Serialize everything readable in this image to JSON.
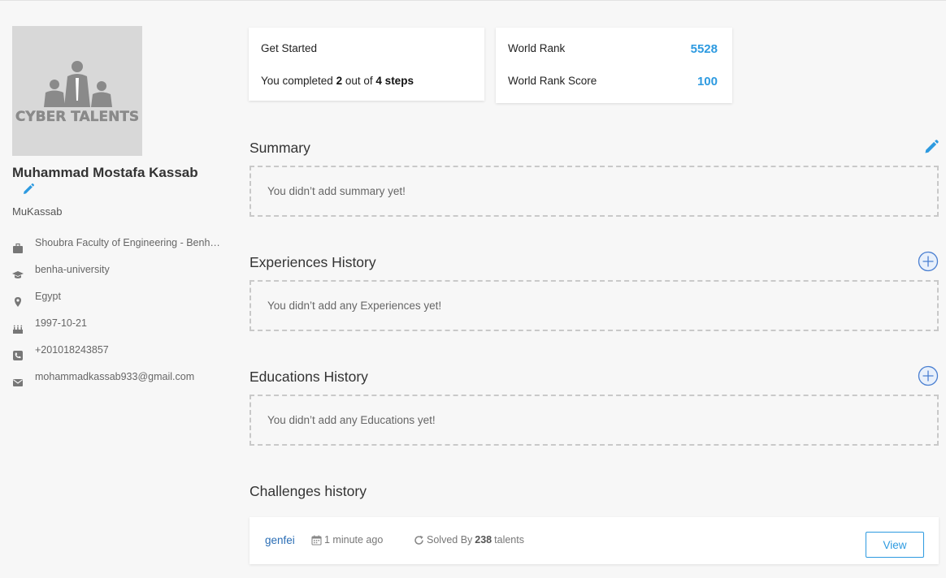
{
  "profile": {
    "logo_text": "CYBER TALENTS",
    "full_name": "Muhammad Mostafa Kassab",
    "username": "MuKassab",
    "info": [
      {
        "icon": "briefcase-icon",
        "text": "Shoubra Faculty of Engineering - Benha University"
      },
      {
        "icon": "graduation-cap-icon",
        "text": "benha-university"
      },
      {
        "icon": "map-pin-icon",
        "text": "Egypt"
      },
      {
        "icon": "birthday-cake-icon",
        "text": "1997-10-21"
      },
      {
        "icon": "phone-icon",
        "text": "+201018243857"
      },
      {
        "icon": "envelope-icon",
        "text": "mohammadkassab933@gmail.com"
      }
    ]
  },
  "get_started": {
    "title": "Get Started",
    "prefix": "You completed",
    "completed": "2",
    "middle": "out of",
    "total": "4 steps"
  },
  "rank": {
    "world_rank_label": "World Rank",
    "world_rank_value": "5528",
    "score_label": "World Rank Score",
    "score_value": "100"
  },
  "sections": {
    "summary": {
      "title": "Summary",
      "empty": "You didn’t add summary yet!"
    },
    "experiences": {
      "title": "Experiences History",
      "empty": "You didn’t add any Experiences yet!"
    },
    "educations": {
      "title": "Educations History",
      "empty": "You didn’t add any Educations yet!"
    },
    "challenges": {
      "title": "Challenges history"
    }
  },
  "challenges": [
    {
      "name": "genfei",
      "time": "1 minute ago",
      "solved_prefix": "Solved By",
      "solved_count": "238",
      "solved_suffix": "talents",
      "view_label": "View"
    }
  ],
  "colors": {
    "accent": "#2d9ae0",
    "link": "#2a6db5",
    "background": "#f7f7f7"
  }
}
